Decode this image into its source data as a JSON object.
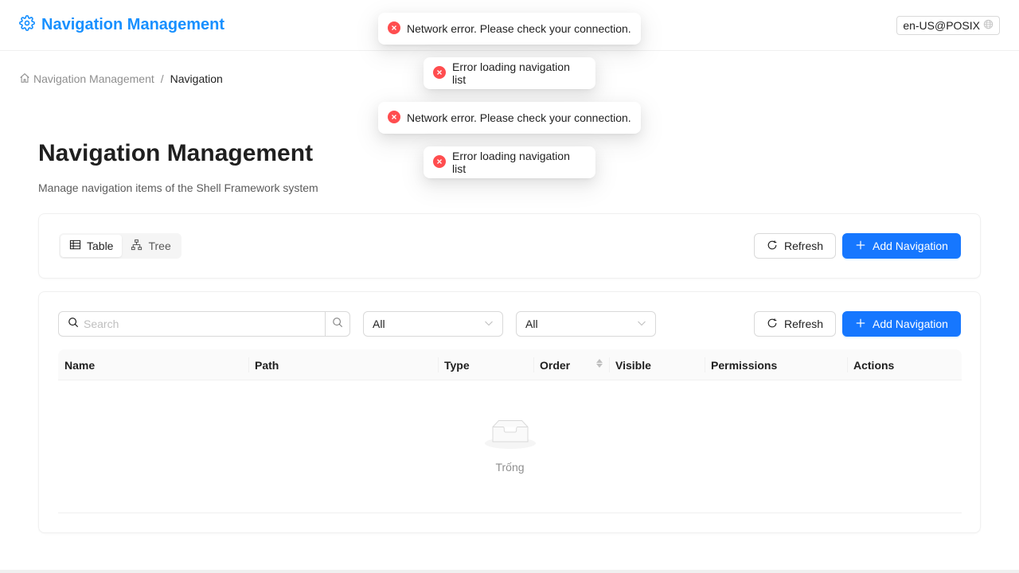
{
  "header": {
    "title": "Navigation Management",
    "locale": "en-US@POSIX"
  },
  "breadcrumb": {
    "home_label": "Navigation Management",
    "separator": "/",
    "current": "Navigation"
  },
  "page": {
    "title": "Navigation Management",
    "subtitle": "Manage navigation items of the Shell Framework system"
  },
  "view_switch": {
    "options": [
      "Table",
      "Tree"
    ],
    "selected": "Table"
  },
  "toolbar": {
    "refresh_label": "Refresh",
    "add_label": "Add Navigation"
  },
  "filters": {
    "search_placeholder": "Search",
    "type_filter": "All",
    "visible_filter": "All"
  },
  "table": {
    "columns": [
      "Name",
      "Path",
      "Type",
      "Order",
      "Visible",
      "Permissions",
      "Actions"
    ],
    "sortable_column": "Order",
    "rows": [],
    "empty_text": "Trống"
  },
  "notifications": [
    {
      "type": "error",
      "text": "Network error. Please check your connection."
    },
    {
      "type": "error",
      "text": "Error loading navigation list"
    },
    {
      "type": "error",
      "text": "Network error. Please check your connection."
    },
    {
      "type": "error",
      "text": "Error loading navigation list"
    }
  ],
  "colors": {
    "brand": "#1890ff",
    "primary": "#1677ff",
    "error": "#ff4d4f"
  }
}
